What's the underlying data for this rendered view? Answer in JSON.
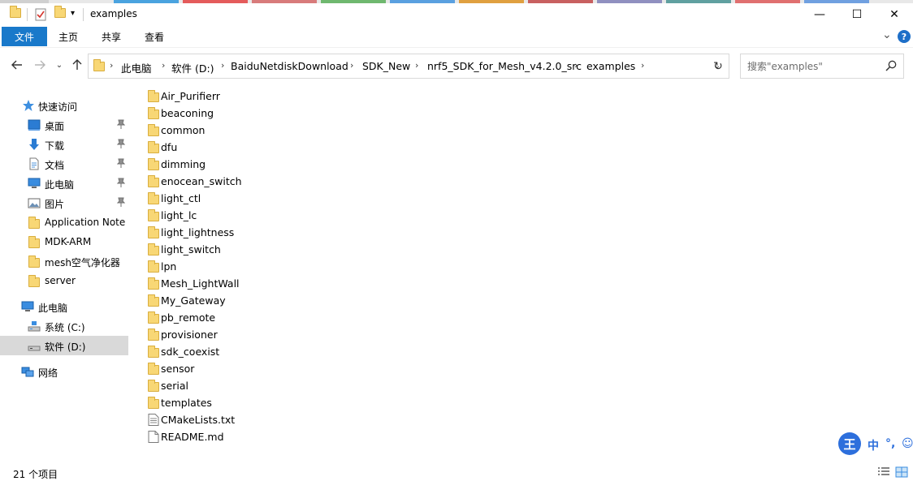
{
  "window": {
    "title": "examples",
    "minimize": "—",
    "maximize": "☐",
    "close": "✕"
  },
  "ribbon": {
    "tabs": [
      "文件",
      "主页",
      "共享",
      "查看"
    ],
    "collapse": "⌄",
    "help": "?"
  },
  "address": {
    "crumbs": [
      "此电脑",
      "软件 (D:)",
      "BaiduNetdiskDownload",
      "SDK_New",
      "nrf5_SDK_for_Mesh_v4.2.0_src",
      "examples"
    ],
    "separator": "›",
    "dropdown": "⌄",
    "refresh": "↻"
  },
  "search": {
    "placeholder": "搜索\"examples\""
  },
  "sidebar": {
    "quick_access": "快速访问",
    "quick_items": [
      {
        "label": "桌面",
        "icon": "desktop-icon",
        "pinned": true
      },
      {
        "label": "下载",
        "icon": "download-icon",
        "pinned": true
      },
      {
        "label": "文档",
        "icon": "document-icon",
        "pinned": true
      },
      {
        "label": "此电脑",
        "icon": "pc-icon",
        "pinned": true
      },
      {
        "label": "图片",
        "icon": "picture-icon",
        "pinned": true
      },
      {
        "label": "Application Note v",
        "icon": "folder-icon",
        "pinned": false
      },
      {
        "label": "MDK-ARM",
        "icon": "folder-icon",
        "pinned": false
      },
      {
        "label": "mesh空气净化器",
        "icon": "folder-icon",
        "pinned": false
      },
      {
        "label": "server",
        "icon": "folder-icon",
        "pinned": false
      }
    ],
    "this_pc": "此电脑",
    "drives": [
      {
        "label": "系统 (C:)",
        "selected": false
      },
      {
        "label": "软件 (D:)",
        "selected": true
      }
    ],
    "network": "网络"
  },
  "files": [
    {
      "name": "Air_Purifierr",
      "type": "folder"
    },
    {
      "name": "beaconing",
      "type": "folder"
    },
    {
      "name": "common",
      "type": "folder"
    },
    {
      "name": "dfu",
      "type": "folder"
    },
    {
      "name": "dimming",
      "type": "folder"
    },
    {
      "name": "enocean_switch",
      "type": "folder"
    },
    {
      "name": "light_ctl",
      "type": "folder"
    },
    {
      "name": "light_lc",
      "type": "folder"
    },
    {
      "name": "light_lightness",
      "type": "folder"
    },
    {
      "name": "light_switch",
      "type": "folder"
    },
    {
      "name": "lpn",
      "type": "folder"
    },
    {
      "name": "Mesh_LightWall",
      "type": "folder"
    },
    {
      "name": "My_Gateway",
      "type": "folder"
    },
    {
      "name": "pb_remote",
      "type": "folder"
    },
    {
      "name": "provisioner",
      "type": "folder"
    },
    {
      "name": "sdk_coexist",
      "type": "folder"
    },
    {
      "name": "sensor",
      "type": "folder"
    },
    {
      "name": "serial",
      "type": "folder"
    },
    {
      "name": "templates",
      "type": "folder"
    },
    {
      "name": "CMakeLists.txt",
      "type": "file"
    },
    {
      "name": "README.md",
      "type": "file"
    }
  ],
  "status": {
    "item_count": "21 个项目"
  },
  "ime": {
    "logo": "王",
    "mode": "中",
    "punct": "°,",
    "emoji": "☺"
  },
  "colors": {
    "accent": "#1979ca",
    "folder": "#f8d775",
    "selected_nav": "#d9d9d9"
  }
}
